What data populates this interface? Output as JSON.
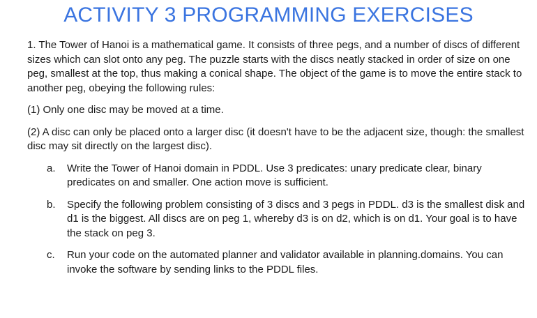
{
  "title": "ACTIVITY 3 PROGRAMMING EXERCISES",
  "intro": "1. The Tower of Hanoi is a mathematical game. It consists of three pegs, and a number of discs of different sizes which can slot onto any peg. The puzzle starts with the discs neatly stacked in order of size on one peg, smallest at the top, thus making a conical shape. The object of the game is to move the entire stack to another peg, obeying the following rules:",
  "rules": [
    "(1) Only one disc may be moved at a time.",
    "(2) A disc can only be placed onto a larger disc (it doesn't have to be the adjacent size, though: the smallest disc may sit directly on the largest disc)."
  ],
  "tasks": [
    {
      "marker": "a.",
      "text": "Write the Tower of Hanoi domain in PDDL. Use 3 predicates: unary predicate clear, binary predicates on and smaller. One action move is sufficient."
    },
    {
      "marker": "b.",
      "text": "Specify the following problem consisting of 3 discs and 3 pegs in PDDL. d3 is the smallest disk and d1 is the biggest. All discs are on peg 1, whereby d3 is on d2, which is on d1. Your goal is to have the stack on peg 3."
    },
    {
      "marker": "c.",
      "text": "Run your code on the automated planner and validator available in planning.domains. You can invoke the software by sending links to the PDDL files."
    }
  ]
}
